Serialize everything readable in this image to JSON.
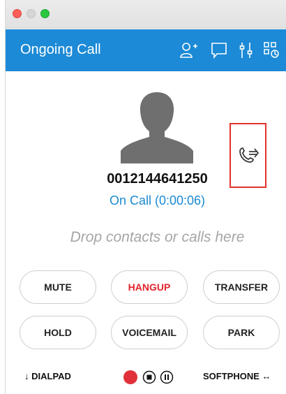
{
  "header": {
    "title": "Ongoing Call",
    "background": "#1c8ad6"
  },
  "call": {
    "number": "0012144641250",
    "status": "On Call (0:00:06)"
  },
  "drop_zone": {
    "text": "Drop contacts or calls here"
  },
  "buttons": {
    "mute": "MUTE",
    "hangup": "HANGUP",
    "transfer": "TRANSFER",
    "hold": "HOLD",
    "voicemail": "VOICEMAIL",
    "park": "PARK"
  },
  "bottom_bar": {
    "dialpad": "DIALPAD",
    "softphone": "SOFTPHONE"
  },
  "colors": {
    "accent": "#1c8ad6",
    "hangup": "#e3232a",
    "record": "#e0313a",
    "highlight_border": "#e3322b"
  },
  "icons": {
    "header": [
      "add-contact-icon",
      "chat-icon",
      "settings-sliders-icon",
      "grid-apps-icon"
    ],
    "transfer": "call-transfer-icon",
    "dialpad": "arrow-down-icon",
    "softphone": "swap-arrows-icon",
    "recording": [
      "record-icon",
      "stop-icon",
      "pause-icon"
    ]
  }
}
